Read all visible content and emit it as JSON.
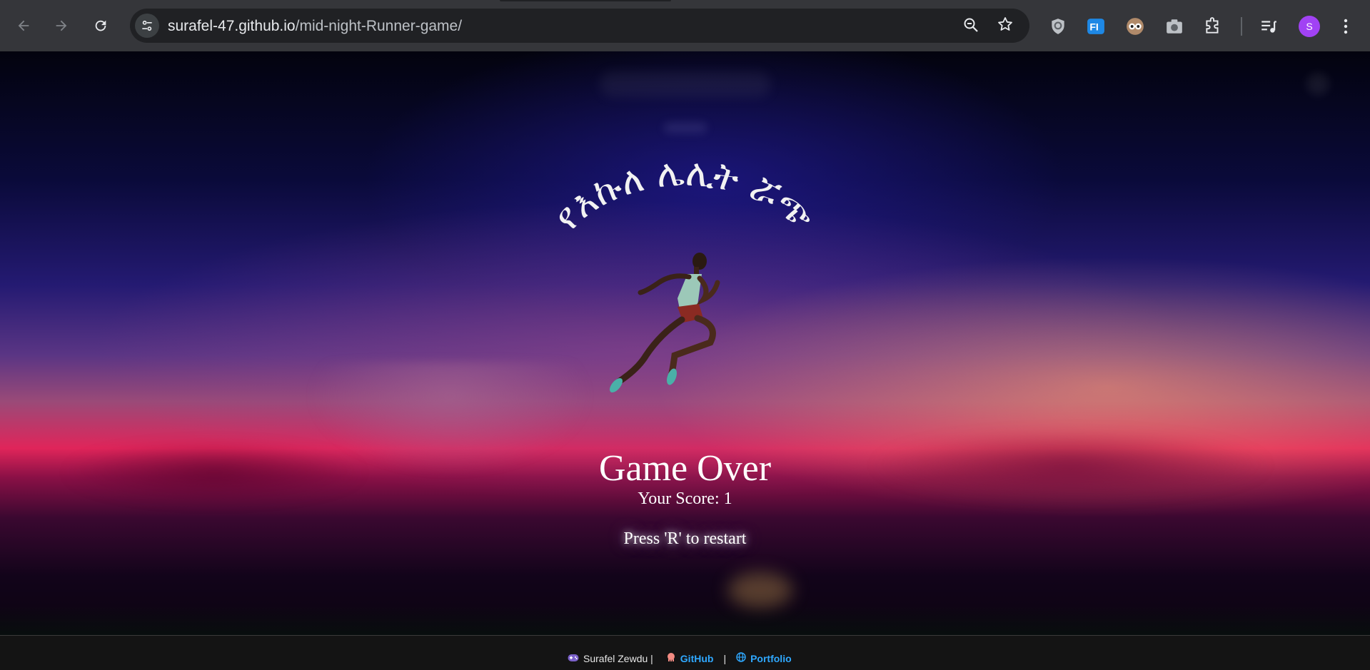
{
  "browser": {
    "url_host": "surafel-47.github.io",
    "url_path": "/mid-night-Runner-game/",
    "profile_initial": "S",
    "icons": {
      "back": "arrow-left-icon",
      "forward": "arrow-right-icon",
      "reload": "reload-icon",
      "site_settings": "tune-icon",
      "zoom": "zoom-out-icon",
      "bookmark": "star-icon",
      "extensions": [
        "shield-extension-icon",
        "fi-extension-icon",
        "owl-extension-icon",
        "camera-extension-icon",
        "puzzle-extensions-icon"
      ],
      "media": "media-queue-icon",
      "menu": "more-vert-icon"
    },
    "accent": "#a142f4"
  },
  "game": {
    "title": "የእኩለ ሌሊት ሯጭ",
    "over_title": "Game Over",
    "score_text": "Your Score: 1",
    "restart_text": "Press 'R' to restart"
  },
  "footer": {
    "author": "Surafel Zewdu |",
    "github_label": "GitHub",
    "separator": "|",
    "portfolio_label": "Portfolio",
    "link_color": "#2fa8ff",
    "icons": [
      "gamepad-icon",
      "octocat-icon",
      "globe-icon"
    ]
  }
}
